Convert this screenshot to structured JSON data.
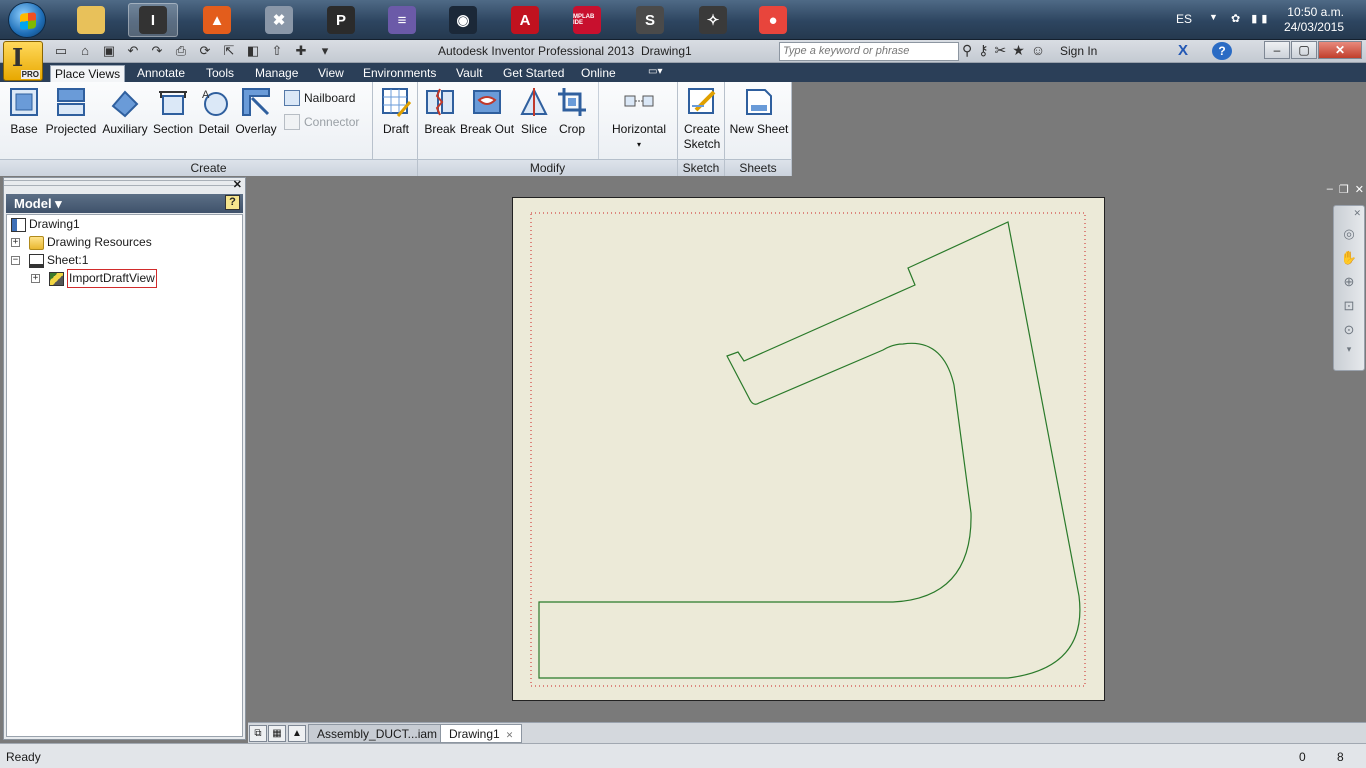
{
  "taskbar": {
    "apps": [
      {
        "name": "windows-explorer",
        "letter": "",
        "color": "#e8c15a"
      },
      {
        "name": "autodesk-inventor",
        "letter": "I",
        "color": "#333333"
      },
      {
        "name": "matlab",
        "letter": "▲",
        "color": "#e35d1c"
      },
      {
        "name": "x-app",
        "letter": "✖",
        "color": "#8a97a8"
      },
      {
        "name": "p-app",
        "letter": "P",
        "color": "#2b2b2b"
      },
      {
        "name": "equalizer-app",
        "letter": "≡",
        "color": "#6b5aa8"
      },
      {
        "name": "steam",
        "letter": "◉",
        "color": "#1b2838"
      },
      {
        "name": "autocad",
        "letter": "A",
        "color": "#c1121f"
      },
      {
        "name": "mplab-ide",
        "letter": "M",
        "color": "#c8102e"
      },
      {
        "name": "sublime-text",
        "letter": "S",
        "color": "#4a4a4a"
      },
      {
        "name": "rhino",
        "letter": "✧",
        "color": "#3a3a3a"
      },
      {
        "name": "chrome",
        "letter": "●",
        "color": "#e8453c"
      }
    ],
    "mplab_label": "MPLAB IDE",
    "language": "ES",
    "time": "10:50 a.m.",
    "date": "24/03/2015"
  },
  "titlebar": {
    "app_title": "Autodesk Inventor Professional 2013",
    "document": "Drawing1",
    "search_placeholder": "Type a keyword or phrase",
    "sign_in": "Sign In",
    "app_badge": "PRO"
  },
  "ribbon": {
    "tabs": [
      "Place Views",
      "Annotate",
      "Tools",
      "Manage",
      "View",
      "Environments",
      "Vault",
      "Get Started",
      "Online"
    ],
    "active_tab": "Place Views",
    "panels": {
      "create": {
        "label": "Create",
        "buttons": [
          "Base",
          "Projected",
          "Auxiliary",
          "Section",
          "Detail",
          "Overlay"
        ],
        "small": {
          "nailboard": "Nailboard",
          "connector": "Connector"
        }
      },
      "draft": {
        "label": "Draft"
      },
      "modify": {
        "label": "Modify",
        "buttons": [
          "Break",
          "Break Out",
          "Slice",
          "Crop"
        ],
        "horizontal": "Horizontal"
      },
      "sketch": {
        "label": "Sketch",
        "button_line1": "Create",
        "button_line2": "Sketch"
      },
      "sheets": {
        "label": "Sheets",
        "button": "New Sheet"
      }
    }
  },
  "browser": {
    "header": "Model ▾",
    "nodes": [
      {
        "label": "Drawing1"
      },
      {
        "label": "Drawing Resources"
      },
      {
        "label": "Sheet:1"
      },
      {
        "label": "ImportDraftView"
      }
    ]
  },
  "doc_tabs": [
    "Assembly_DUCT...iam",
    "Drawing1"
  ],
  "status": {
    "text": "Ready",
    "num1": "0",
    "num2": "8"
  },
  "drawing": {
    "outline_color": "#2a7a2a",
    "border_color": "#cc2222",
    "sheet_color": "#ecead8"
  }
}
